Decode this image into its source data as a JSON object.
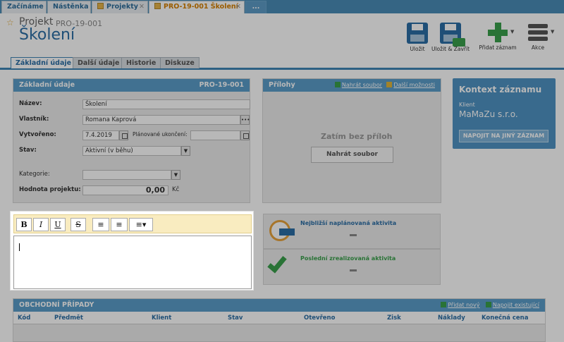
{
  "top_tabs": [
    {
      "label": "Začínáme"
    },
    {
      "label": "Nástěnka"
    },
    {
      "label": "Projekty"
    },
    {
      "label": "PRO-19-001 Školení"
    },
    {
      "label": "..."
    }
  ],
  "header": {
    "entity_label": "Projekt",
    "code": "PRO-19-001",
    "title": "Školení"
  },
  "toolbar": {
    "save": "Uložit",
    "save_close": "Uložit & Zavřít",
    "add_record": "Přidat záznam",
    "actions": "Akce"
  },
  "sub_tabs": [
    "Základní údaje",
    "Další údaje",
    "Historie",
    "Diskuze"
  ],
  "basic_panel": {
    "title": "Základní údaje",
    "code": "PRO-19-001",
    "fields": {
      "name_label": "Název:",
      "name_value": "Školení",
      "owner_label": "Vlastník:",
      "owner_value": "Romana Kaprová",
      "created_label": "Vytvořeno:",
      "created_value": "7.4.2019",
      "planned_end_label": "Plánované ukončení:",
      "planned_end_value": "",
      "state_label": "Stav:",
      "state_value": "Aktivní (v běhu)",
      "category_label": "Kategorie:",
      "category_value": "",
      "value_label": "Hodnota projektu:",
      "value_value": "0,00",
      "currency": "Kč"
    }
  },
  "editor": {
    "buttons": [
      "B",
      "I",
      "U",
      "S",
      "≡",
      "≡",
      "≡▾"
    ]
  },
  "attachments": {
    "title": "Přílohy",
    "upload_link": "Nahrát soubor",
    "more_link": "Další možnosti",
    "empty_text": "Zatím bez příloh",
    "upload_button": "Nahrát soubor"
  },
  "activities": {
    "next_title": "Nejbližší naplánovaná aktivita",
    "last_title": "Poslední zrealizovaná aktivita"
  },
  "context": {
    "title": "Kontext záznamu",
    "client_label": "Klient",
    "client_value": "MaMaZu s.r.o.",
    "button": "NAPOJIT NA JINÝ ZÁZNAM"
  },
  "cases": {
    "title": "OBCHODNÍ PŘÍPADY",
    "add_new": "Přidat nový",
    "link_existing": "Napojit existující",
    "columns": [
      "Kód",
      "Předmět",
      "Klient",
      "Stav",
      "Otevřeno",
      "Zisk",
      "Náklady",
      "Konečná cena"
    ]
  },
  "colors": {
    "accent_blue": "#2b6ea5",
    "panel_header": "#5b9dc9",
    "context_bg": "#4f93c4",
    "active_tab_text": "#d68000",
    "toolbar_green": "#3aa04b",
    "editor_toolbar": "#f9ecc0"
  }
}
